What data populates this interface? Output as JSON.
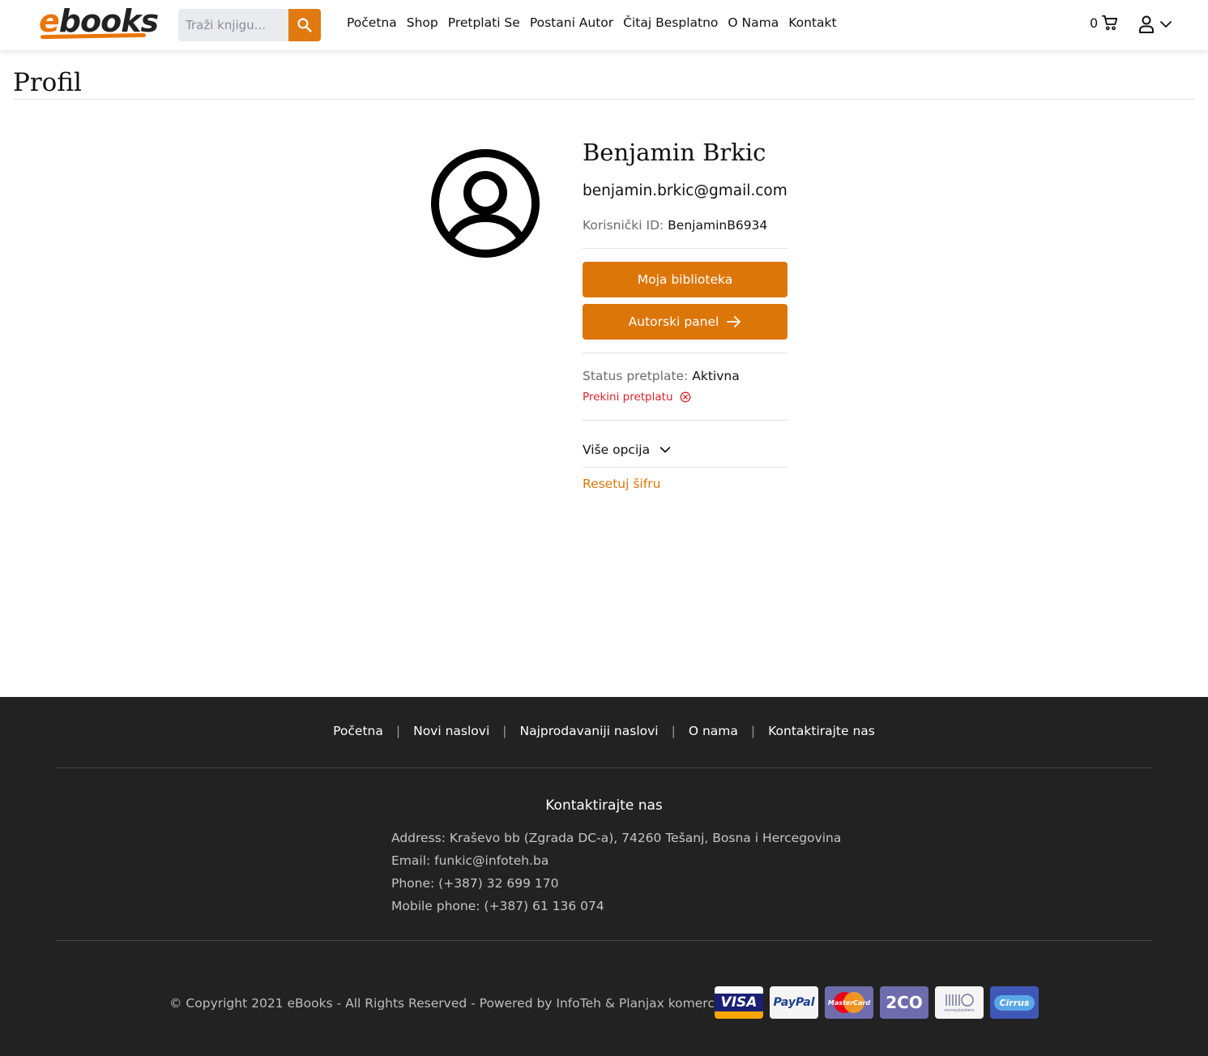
{
  "header": {
    "logo_prefix": "e",
    "logo_rest": "books",
    "search_placeholder": "Traži knjigu...",
    "nav": [
      "Početna",
      "Shop",
      "Pretplati Se",
      "Postani Autor",
      "Čitaj Besplatno",
      "O Nama",
      "Kontakt"
    ],
    "cart_count": "0"
  },
  "page": {
    "title": "Profil"
  },
  "profile": {
    "name": "Benjamin Brkic",
    "email": "benjamin.brkic@gmail.com",
    "user_id_label": "Korisnički ID:",
    "user_id": "BenjaminB6934",
    "library_button": "Moja biblioteka",
    "author_button": "Autorski panel",
    "status_label": "Status pretplate:",
    "status_value": "Aktivna",
    "cancel_link": "Prekini pretplatu",
    "more_options": "Više opcija",
    "reset_password": "Resetuj šifru"
  },
  "footer": {
    "nav": [
      "Početna",
      "Novi naslovi",
      "Najprodavaniji naslovi",
      "O nama",
      "Kontaktirajte nas"
    ],
    "separator": "|",
    "contact_title": "Kontaktirajte nas",
    "address": "Address: Kraševo bb (Zgrada DC-a), 74260 Tešanj, Bosna i Hercegovina",
    "email": "Email: funkic@infoteh.ba",
    "phone": "Phone: (+387) 32 699 170",
    "mobile": "Mobile phone: (+387) 61 136 074",
    "copyright": "© Copyright 2021 eBooks - All Rights Reserved - Powered by InfoTeh & Planjax komerc",
    "payments": [
      "VISA",
      "PayPal",
      "MasterCard",
      "2CO",
      "moneybookers",
      "Cirrus"
    ]
  },
  "colors": {
    "accent": "#dc7608",
    "danger": "#d8252a",
    "footer_bg": "#222222"
  }
}
